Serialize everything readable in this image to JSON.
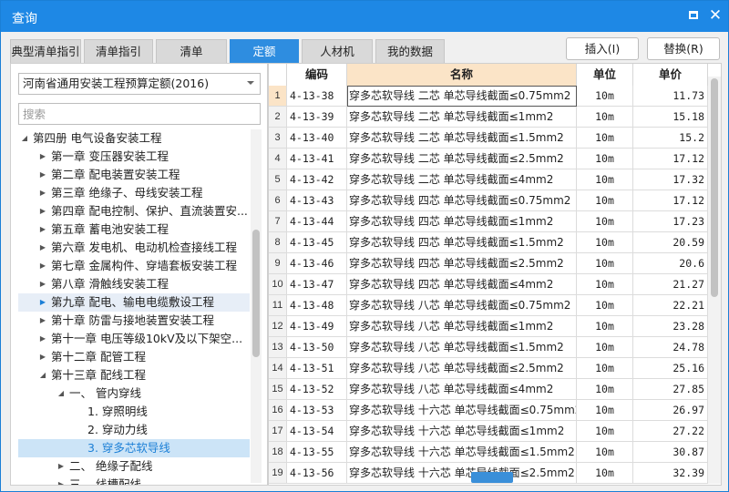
{
  "window": {
    "title": "查询"
  },
  "tabs": [
    {
      "label": "典型清单指引",
      "active": false
    },
    {
      "label": "清单指引",
      "active": false
    },
    {
      "label": "清单",
      "active": false
    },
    {
      "label": "定额",
      "active": true
    },
    {
      "label": "人材机",
      "active": false
    },
    {
      "label": "我的数据",
      "active": false
    }
  ],
  "buttons": {
    "insert": "插入(I)",
    "replace": "替换(R)"
  },
  "quota_library": {
    "selected": "河南省通用安装工程预算定额(2016)"
  },
  "search": {
    "placeholder": "搜索",
    "value": ""
  },
  "tree": [
    {
      "label": "第四册 电气设备安装工程",
      "level": 0,
      "expanded": true
    },
    {
      "label": "第一章 变压器安装工程",
      "level": 1
    },
    {
      "label": "第二章 配电装置安装工程",
      "level": 1
    },
    {
      "label": "第三章 绝缘子、母线安装工程",
      "level": 1
    },
    {
      "label": "第四章 配电控制、保护、直流装置安...",
      "level": 1
    },
    {
      "label": "第五章 蓄电池安装工程",
      "level": 1
    },
    {
      "label": "第六章 发电机、电动机检查接线工程",
      "level": 1
    },
    {
      "label": "第七章 金属构件、穿墙套板安装工程",
      "level": 1
    },
    {
      "label": "第八章 滑触线安装工程",
      "level": 1
    },
    {
      "label": "第九章 配电、输电电缆敷设工程",
      "level": 1,
      "highlight": true
    },
    {
      "label": "第十章 防雷与接地装置安装工程",
      "level": 1
    },
    {
      "label": "第十一章 电压等级10kV及以下架空...",
      "level": 1
    },
    {
      "label": "第十二章 配管工程",
      "level": 1
    },
    {
      "label": "第十三章 配线工程",
      "level": 1,
      "expanded": true
    },
    {
      "label": "一、 管内穿线",
      "level": 2,
      "expanded": true
    },
    {
      "label": "1. 穿照明线",
      "level": 3
    },
    {
      "label": "2. 穿动力线",
      "level": 3
    },
    {
      "label": "3. 穿多芯软导线",
      "level": 3,
      "current": true
    },
    {
      "label": "二、 绝缘子配线",
      "level": 2
    },
    {
      "label": "三、 线槽配线",
      "level": 2
    }
  ],
  "table": {
    "columns": [
      "",
      "编码",
      "名称",
      "单位",
      "单价"
    ],
    "rows": [
      [
        "1",
        "4-13-38",
        "穿多芯软导线 二芯 单芯导线截面≤0.75mm2",
        "10m",
        "11.73"
      ],
      [
        "2",
        "4-13-39",
        "穿多芯软导线 二芯 单芯导线截面≤1mm2",
        "10m",
        "15.18"
      ],
      [
        "3",
        "4-13-40",
        "穿多芯软导线 二芯 单芯导线截面≤1.5mm2",
        "10m",
        "15.2"
      ],
      [
        "4",
        "4-13-41",
        "穿多芯软导线 二芯 单芯导线截面≤2.5mm2",
        "10m",
        "17.12"
      ],
      [
        "5",
        "4-13-42",
        "穿多芯软导线 二芯 单芯导线截面≤4mm2",
        "10m",
        "17.32"
      ],
      [
        "6",
        "4-13-43",
        "穿多芯软导线 四芯 单芯导线截面≤0.75mm2",
        "10m",
        "17.12"
      ],
      [
        "7",
        "4-13-44",
        "穿多芯软导线 四芯 单芯导线截面≤1mm2",
        "10m",
        "17.23"
      ],
      [
        "8",
        "4-13-45",
        "穿多芯软导线 四芯 单芯导线截面≤1.5mm2",
        "10m",
        "20.59"
      ],
      [
        "9",
        "4-13-46",
        "穿多芯软导线 四芯 单芯导线截面≤2.5mm2",
        "10m",
        "20.6"
      ],
      [
        "10",
        "4-13-47",
        "穿多芯软导线 四芯 单芯导线截面≤4mm2",
        "10m",
        "21.27"
      ],
      [
        "11",
        "4-13-48",
        "穿多芯软导线 八芯 单芯导线截面≤0.75mm2",
        "10m",
        "22.21"
      ],
      [
        "12",
        "4-13-49",
        "穿多芯软导线 八芯 单芯导线截面≤1mm2",
        "10m",
        "23.28"
      ],
      [
        "13",
        "4-13-50",
        "穿多芯软导线 八芯 单芯导线截面≤1.5mm2",
        "10m",
        "24.78"
      ],
      [
        "14",
        "4-13-51",
        "穿多芯软导线 八芯 单芯导线截面≤2.5mm2",
        "10m",
        "25.16"
      ],
      [
        "15",
        "4-13-52",
        "穿多芯软导线 八芯 单芯导线截面≤4mm2",
        "10m",
        "27.85"
      ],
      [
        "16",
        "4-13-53",
        "穿多芯软导线 十六芯 单芯导线截面≤0.75mm2",
        "10m",
        "26.97"
      ],
      [
        "17",
        "4-13-54",
        "穿多芯软导线 十六芯 单芯导线截面≤1mm2",
        "10m",
        "27.22"
      ],
      [
        "18",
        "4-13-55",
        "穿多芯软导线 十六芯 单芯导线截面≤1.5mm2",
        "10m",
        "30.87"
      ],
      [
        "19",
        "4-13-56",
        "穿多芯软导线 十六芯 单芯导线截面≤2.5mm2",
        "10m",
        "32.39"
      ]
    ]
  },
  "colors": {
    "accent": "#1e88e5",
    "tab_active": "#2e8de0",
    "header_selected": "#fbe4c7",
    "tree_current": "#cce4f7"
  }
}
